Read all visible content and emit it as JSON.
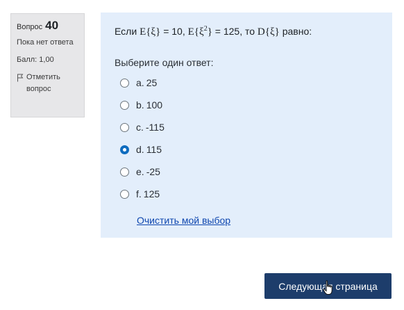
{
  "info": {
    "question_label": "Вопрос",
    "question_number": "40",
    "state": "Пока нет ответа",
    "grade": "Балл: 1,00",
    "flag_label": "Отметить вопрос"
  },
  "question": {
    "prefix": "Если",
    "e1": "E{ξ}",
    "eq1": " = 10, ",
    "e2_base": "E{ξ",
    "e2_sup": "2",
    "e2_close": "}",
    "eq2": " = 125, то ",
    "d": "D{ξ}",
    "suffix": " равно:",
    "prompt": "Выберите один ответ:"
  },
  "answers": [
    {
      "letter": "a.",
      "text": "25",
      "checked": false
    },
    {
      "letter": "b.",
      "text": "100",
      "checked": false
    },
    {
      "letter": "c.",
      "text": "-115",
      "checked": false
    },
    {
      "letter": "d.",
      "text": "115",
      "checked": true
    },
    {
      "letter": "e.",
      "text": "-25",
      "checked": false
    },
    {
      "letter": "f.",
      "text": "125",
      "checked": false
    }
  ],
  "clear_choice": "Очистить мой выбор",
  "next_button": "Следующая страница",
  "colors": {
    "panel_bg": "#e3eefb",
    "info_bg": "#e7e7e9",
    "button_bg": "#1d3d6b",
    "accent": "#0f6cbf"
  }
}
